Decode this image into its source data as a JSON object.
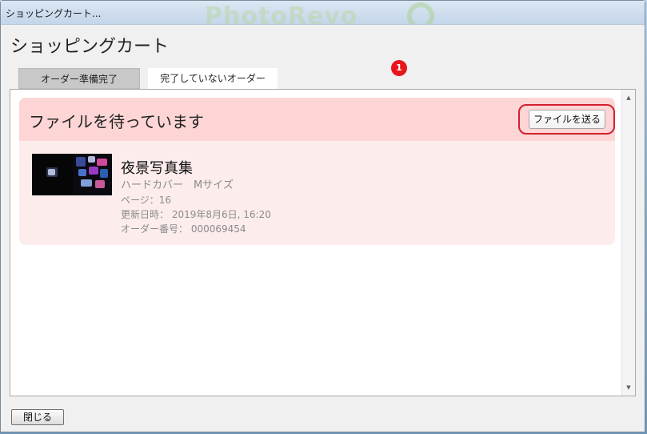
{
  "window": {
    "title": "ショッピングカート...",
    "brand_text": "PhotoRevo"
  },
  "page": {
    "heading": "ショッピングカート"
  },
  "tabs": [
    {
      "label": "オーダー準備完了",
      "active": false
    },
    {
      "label": "完了していないオーダー",
      "active": true,
      "badge": "1"
    }
  ],
  "card": {
    "status_title": "ファイルを待っています",
    "send_button_label": "ファイルを送る",
    "item": {
      "title": "夜景写真集",
      "product": "ハードカバー　Mサイズ",
      "pages": "ページ：16",
      "updated": "更新日時： 2019年8月6日, 16:20",
      "order_number": "オーダー番号： 000069454"
    }
  },
  "footer": {
    "close_label": "閉じる"
  },
  "colors": {
    "card_header_bg": "#fdd5d5",
    "card_body_bg": "#fcecec",
    "badge_bg": "#e8161b",
    "highlight": "#d2202e"
  },
  "icons": {
    "scroll_up": "chevron-up-icon",
    "scroll_down": "chevron-down-icon",
    "thumbnail": "photobook-thumbnail"
  }
}
